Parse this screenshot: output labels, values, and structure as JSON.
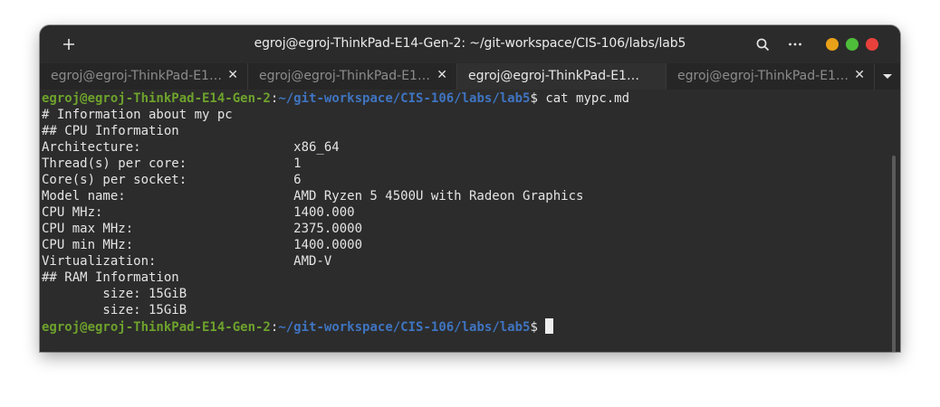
{
  "window": {
    "title": "egroj@egroj-ThinkPad-E14-Gen-2: ~/git-workspace/CIS-106/labs/lab5",
    "controls": {
      "minimize_color": "#e8a118",
      "maximize_color": "#4ebd3a",
      "close_color": "#e8413c"
    }
  },
  "tabs": [
    {
      "label": "egroj@egroj-ThinkPad-E1…",
      "active": false
    },
    {
      "label": "egroj@egroj-ThinkPad-E1…",
      "active": false
    },
    {
      "label": "egroj@egroj-ThinkPad-E1…",
      "active": true
    },
    {
      "label": "egroj@egroj-ThinkPad-E1…",
      "active": false
    }
  ],
  "terminal": {
    "prompt_user": "egroj@egroj-ThinkPad-E14-Gen-2",
    "prompt_colon": ":",
    "prompt_path": "~/git-workspace/CIS-106/labs/lab5",
    "prompt_symbol": "$ ",
    "command": "cat mypc.md",
    "output": [
      "# Information about my pc",
      "## CPU Information",
      "Architecture:                    x86_64",
      "Thread(s) per core:              1",
      "Core(s) per socket:              6",
      "Model name:                      AMD Ryzen 5 4500U with Radeon Graphics",
      "CPU MHz:                         1400.000",
      "CPU max MHz:                     2375.0000",
      "CPU min MHz:                     1400.0000",
      "Virtualization:                  AMD-V",
      "## RAM Information",
      "        size: 15GiB",
      "        size: 15GiB"
    ]
  },
  "icons": {
    "new_tab": "plus-icon",
    "search": "search-icon",
    "menu": "ellipsis-icon",
    "tab_close": "close-icon",
    "tab_list": "chevron-down-icon"
  }
}
